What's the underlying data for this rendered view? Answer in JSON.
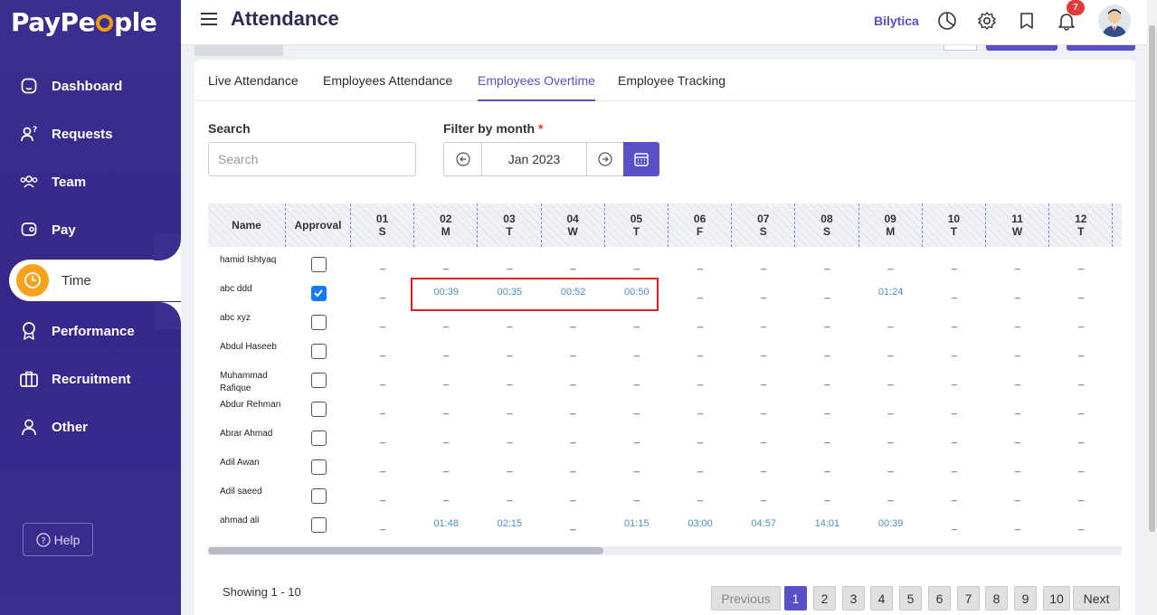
{
  "app": {
    "logo": "PayPeople",
    "colors": {
      "brand": "#3a2e8e",
      "accent": "#5a4fc7",
      "active_icon": "#f7a21b",
      "link_value": "#4a90c8",
      "highlight": "#e02020"
    }
  },
  "sidebar": {
    "items": [
      {
        "label": "Dashboard",
        "icon": "home-icon"
      },
      {
        "label": "Requests",
        "icon": "person-question-icon"
      },
      {
        "label": "Team",
        "icon": "team-icon"
      },
      {
        "label": "Pay",
        "icon": "wallet-icon"
      },
      {
        "label": "Time",
        "icon": "clock-icon",
        "active": true
      },
      {
        "label": "Performance",
        "icon": "award-icon"
      },
      {
        "label": "Recruitment",
        "icon": "briefcase-icon"
      },
      {
        "label": "Other",
        "icon": "user-icon"
      }
    ],
    "help_label": "Help"
  },
  "header": {
    "title": "Attendance",
    "company": "Bilytica",
    "notification_count": "7"
  },
  "tabs": [
    {
      "label": "Live Attendance"
    },
    {
      "label": "Employees Attendance"
    },
    {
      "label": "Employees Overtime",
      "active": true
    },
    {
      "label": "Employee Tracking"
    }
  ],
  "filters": {
    "search_label": "Search",
    "search_placeholder": "Search",
    "month_label": "Filter by month",
    "month_required": "*",
    "month_value": "Jan 2023"
  },
  "table": {
    "name_header": "Name",
    "approval_header": "Approval",
    "days": [
      {
        "d": "01",
        "w": "S"
      },
      {
        "d": "02",
        "w": "M"
      },
      {
        "d": "03",
        "w": "T"
      },
      {
        "d": "04",
        "w": "W"
      },
      {
        "d": "05",
        "w": "T"
      },
      {
        "d": "06",
        "w": "F"
      },
      {
        "d": "07",
        "w": "S"
      },
      {
        "d": "08",
        "w": "S"
      },
      {
        "d": "09",
        "w": "M"
      },
      {
        "d": "10",
        "w": "T"
      },
      {
        "d": "11",
        "w": "W"
      },
      {
        "d": "12",
        "w": "T"
      }
    ],
    "rows": [
      {
        "name": "hamid Ishtyaq",
        "approved": false,
        "values": [
          "_",
          "_",
          "_",
          "_",
          "_",
          "_",
          "_",
          "_",
          "_",
          "_",
          "_",
          "_"
        ]
      },
      {
        "name": "abc ddd",
        "approved": true,
        "values": [
          "_",
          "00:39",
          "00:35",
          "00:52",
          "00:50",
          "_",
          "_",
          "_",
          "01:24",
          "_",
          "_",
          "_"
        ]
      },
      {
        "name": "abc xyz",
        "approved": false,
        "values": [
          "_",
          "_",
          "_",
          "_",
          "_",
          "_",
          "_",
          "_",
          "_",
          "_",
          "_",
          "_"
        ]
      },
      {
        "name": "Abdul Haseeb",
        "approved": false,
        "values": [
          "_",
          "_",
          "_",
          "_",
          "_",
          "_",
          "_",
          "_",
          "_",
          "_",
          "_",
          "_"
        ]
      },
      {
        "name": "Muhammad Rafique",
        "approved": false,
        "values": [
          "_",
          "_",
          "_",
          "_",
          "_",
          "_",
          "_",
          "_",
          "_",
          "_",
          "_",
          "_"
        ]
      },
      {
        "name": "Abdur Rehman",
        "approved": false,
        "values": [
          "_",
          "_",
          "_",
          "_",
          "_",
          "_",
          "_",
          "_",
          "_",
          "_",
          "_",
          "_"
        ]
      },
      {
        "name": "Abrar Ahmad",
        "approved": false,
        "values": [
          "_",
          "_",
          "_",
          "_",
          "_",
          "_",
          "_",
          "_",
          "_",
          "_",
          "_",
          "_"
        ]
      },
      {
        "name": "Adil Awan",
        "approved": false,
        "values": [
          "_",
          "_",
          "_",
          "_",
          "_",
          "_",
          "_",
          "_",
          "_",
          "_",
          "_",
          "_"
        ]
      },
      {
        "name": "Adil saeed",
        "approved": false,
        "values": [
          "_",
          "_",
          "_",
          "_",
          "_",
          "_",
          "_",
          "_",
          "_",
          "_",
          "_",
          "_"
        ]
      },
      {
        "name": "ahmad ali",
        "approved": false,
        "values": [
          "_",
          "01:48",
          "02:15",
          "_",
          "01:15",
          "03:00",
          "04:57",
          "14:01",
          "00:39",
          "_",
          "_",
          "_"
        ]
      }
    ]
  },
  "footer": {
    "showing": "Showing 1 - 10",
    "previous": "Previous",
    "next": "Next",
    "pages": [
      "1",
      "2",
      "3",
      "4",
      "5",
      "6",
      "7",
      "8",
      "9",
      "10"
    ],
    "current_page": "1"
  }
}
